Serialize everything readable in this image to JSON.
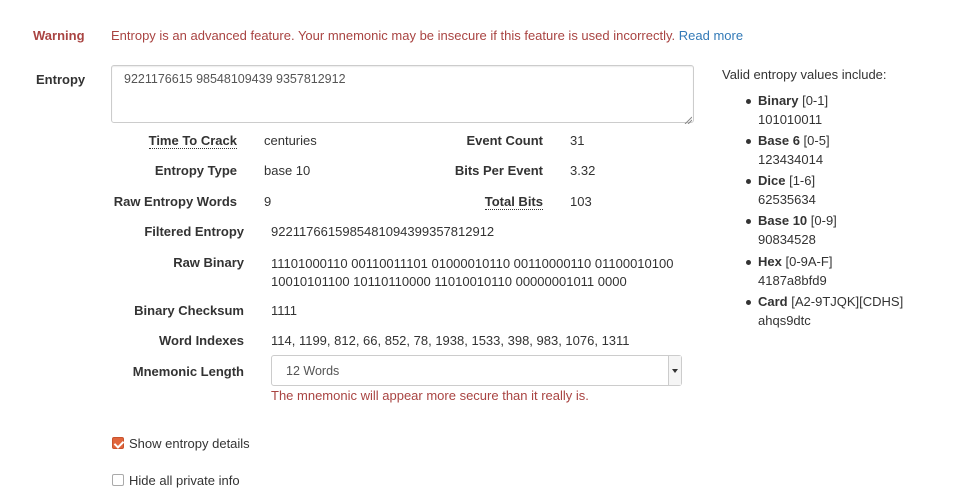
{
  "warning": {
    "label": "Warning",
    "text": "Entropy is an advanced feature. Your mnemonic may be insecure if this feature is used incorrectly.",
    "link": "Read more"
  },
  "entropy": {
    "label": "Entropy",
    "value": "9221176615 98548109439 9357812912"
  },
  "stats": {
    "time_to_crack_label": "Time To Crack",
    "time_to_crack_value": "centuries",
    "event_count_label": "Event Count",
    "event_count_value": "31",
    "entropy_type_label": "Entropy Type",
    "entropy_type_value": "base 10",
    "bits_per_event_label": "Bits Per Event",
    "bits_per_event_value": "3.32",
    "raw_entropy_words_label": "Raw Entropy Words",
    "raw_entropy_words_value": "9",
    "total_bits_label": "Total Bits",
    "total_bits_value": "103"
  },
  "details": {
    "filtered_label": "Filtered Entropy",
    "filtered_value": "9221176615985481094399357812912",
    "raw_binary_label": "Raw Binary",
    "raw_binary_line1": "11101000110 00110011101 01000010110 00110000110 01100010100",
    "raw_binary_line2": "10010101100 10110110000 11010010110 00000001011 0000",
    "checksum_label": "Binary Checksum",
    "checksum_value": "1111",
    "word_indexes_label": "Word Indexes",
    "word_indexes_value": "114, 1199, 812, 66, 852, 78, 1938, 1533, 398, 983, 1076, 1311"
  },
  "mnemonic": {
    "label": "Mnemonic Length",
    "selected": "12 Words",
    "warning": "The mnemonic will appear more secure than it really is."
  },
  "options": {
    "show_entropy_details": "Show entropy details",
    "show_entropy_checked": true,
    "hide_private": "Hide all private info",
    "hide_private_checked": false
  },
  "valid_values": {
    "title": "Valid entropy values include:",
    "items": [
      {
        "name": "Binary",
        "range": "[0-1]",
        "example": "101010011"
      },
      {
        "name": "Base 6",
        "range": "[0-5]",
        "example": "123434014"
      },
      {
        "name": "Dice",
        "range": "[1-6]",
        "example": "62535634"
      },
      {
        "name": "Base 10",
        "range": "[0-9]",
        "example": "90834528"
      },
      {
        "name": "Hex",
        "range": "[0-9A-F]",
        "example": "4187a8bfd9"
      },
      {
        "name": "Card",
        "range": "[A2-9TJQK][CDHS]",
        "example": "ahqs9dtc"
      }
    ]
  },
  "colors": {
    "warning": "#a94442",
    "link": "#337ab7",
    "checkbox": "#e0653c"
  }
}
